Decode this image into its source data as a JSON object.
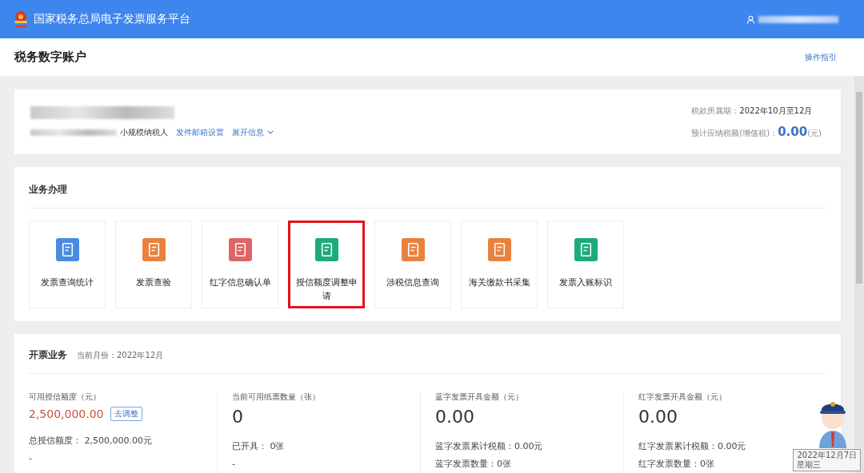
{
  "header": {
    "title": "国家税务总局电子发票服务平台"
  },
  "page": {
    "title": "税务数字账户",
    "guide_link": "操作指引"
  },
  "account": {
    "taxpayer_type": "小规模纳税人",
    "links": [
      "发件邮箱设置",
      "展开信息"
    ],
    "period_label": "税款所属期：",
    "period_value": "2022年10月至12月",
    "tax_label": "预计应纳税额(增值税)：",
    "tax_value": "0.00",
    "tax_unit": "(元)"
  },
  "business": {
    "title": "业务办理",
    "tiles": [
      {
        "label": "发票查询统计",
        "color": "#4a8be0",
        "highlighted": false
      },
      {
        "label": "发票查验",
        "color": "#e8823f",
        "highlighted": false
      },
      {
        "label": "红字信息确认单",
        "color": "#dd6565",
        "highlighted": false
      },
      {
        "label": "授信额度调整申请",
        "color": "#1daa7d",
        "highlighted": true
      },
      {
        "label": "涉税信息查询",
        "color": "#e8823f",
        "highlighted": false
      },
      {
        "label": "海关缴款书采集",
        "color": "#e8823f",
        "highlighted": false
      },
      {
        "label": "发票入账标识",
        "color": "#1daa7d",
        "highlighted": false
      }
    ]
  },
  "invoicing": {
    "title": "开票业务",
    "month": "当前月份：2022年12月",
    "stats": [
      {
        "label": "可用授信额度（元）",
        "value": "2,500,000.00",
        "kind": "credit",
        "button": "去调整",
        "lines": [
          "总授信额度： 2,500,000.00元",
          "-"
        ]
      },
      {
        "label": "当前可用纸票数量（张）",
        "value": "0",
        "kind": "plain",
        "lines": [
          "已开具： 0张",
          "-"
        ]
      },
      {
        "label": "蓝字发票开具金额（元）",
        "value": "0.00",
        "kind": "plain",
        "lines": [
          "蓝字发票累计税额：0.00元",
          "蓝字发票数量：0张"
        ]
      },
      {
        "label": "红字发票开具金额（元）",
        "value": "0.00",
        "kind": "plain",
        "lines": [
          "红字发票累计税额：0.00元",
          "红字发票数量：0张"
        ]
      }
    ]
  },
  "assistant": {
    "date": "2022年12月7日",
    "weekday": "星期三"
  }
}
